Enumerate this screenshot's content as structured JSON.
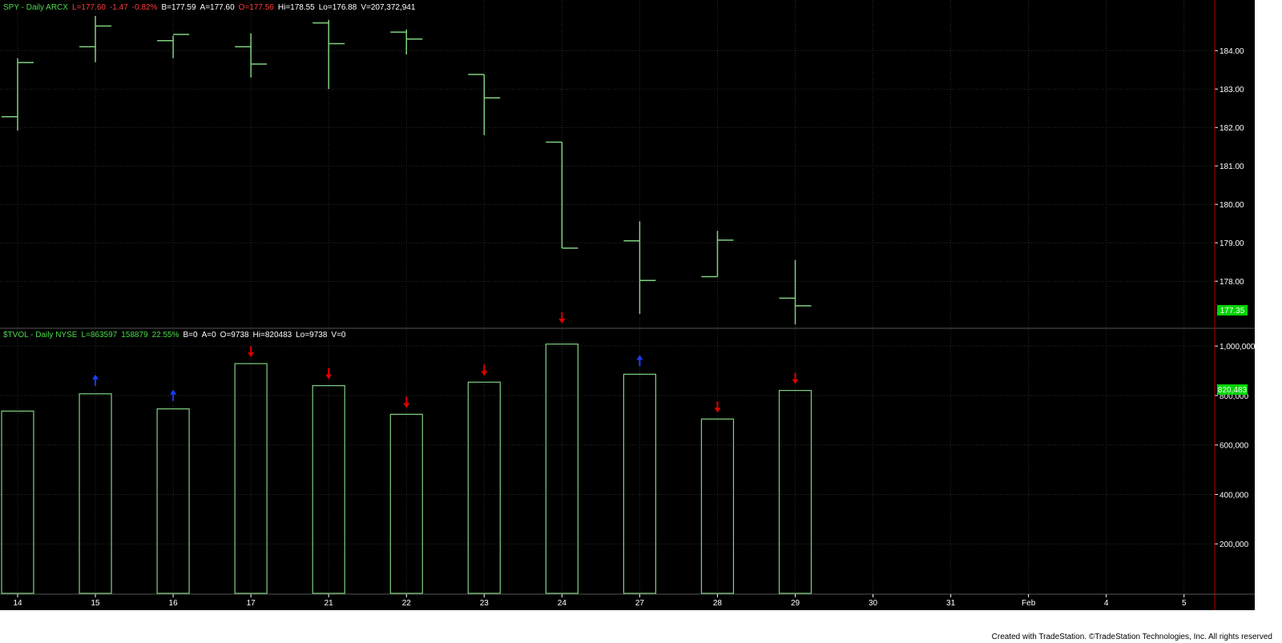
{
  "colors": {
    "background": "#000000",
    "bar": "#7fd17f",
    "grid": "#2a2a2a",
    "axis_text": "#ffffff",
    "header_green": "#4cd94c",
    "header_red": "#ff3b3b",
    "header_white": "#ffffff",
    "down_arrow": "#e00000",
    "up_arrow": "#1a3cff",
    "last_value_bg": "#00d400",
    "divider": "#b00000"
  },
  "price_panel": {
    "header": [
      {
        "text": "SPY - Daily  ARCX",
        "color": "green"
      },
      {
        "text": "L=177.60",
        "color": "red"
      },
      {
        "text": "-1.47",
        "color": "red"
      },
      {
        "text": "-0.82%",
        "color": "red"
      },
      {
        "text": "B=177.59",
        "color": "white"
      },
      {
        "text": "A=177.60",
        "color": "white"
      },
      {
        "text": "O=177.56",
        "color": "red"
      },
      {
        "text": "Hi=178.55",
        "color": "white"
      },
      {
        "text": "Lo=176.88",
        "color": "white"
      },
      {
        "text": "V=207,372,941",
        "color": "white"
      }
    ],
    "last_value_label": "177.35"
  },
  "volume_panel": {
    "header": [
      {
        "text": "$TVOL - Daily  NYSE",
        "color": "green"
      },
      {
        "text": "L=863597",
        "color": "green"
      },
      {
        "text": "158879",
        "color": "green"
      },
      {
        "text": "22.55%",
        "color": "green"
      },
      {
        "text": "B=0",
        "color": "white"
      },
      {
        "text": "A=0",
        "color": "white"
      },
      {
        "text": "O=9738",
        "color": "white"
      },
      {
        "text": "Hi=820483",
        "color": "white"
      },
      {
        "text": "Lo=9738",
        "color": "white"
      },
      {
        "text": "V=0",
        "color": "white"
      }
    ],
    "last_value_label": "820,483"
  },
  "chart_data": [
    {
      "type": "ohlc",
      "title": "SPY - Daily  ARCX",
      "ylim": [
        176.9,
        184.9
      ],
      "y_ticks": [
        178,
        179,
        180,
        181,
        182,
        183,
        184
      ],
      "y_tick_labels": [
        "178.00",
        "179.00",
        "180.00",
        "181.00",
        "182.00",
        "183.00",
        "184.00"
      ],
      "categories": [
        "14",
        "15",
        "16",
        "17",
        "21",
        "22",
        "23",
        "24",
        "27",
        "28",
        "29"
      ],
      "open": [
        182.28,
        184.1,
        184.26,
        184.1,
        184.72,
        184.48,
        183.38,
        181.62,
        179.05,
        178.12,
        177.56
      ],
      "high": [
        183.8,
        184.9,
        184.39,
        184.45,
        184.8,
        184.55,
        183.38,
        181.62,
        179.56,
        179.31,
        178.55
      ],
      "low": [
        181.92,
        183.7,
        183.8,
        183.3,
        183.0,
        183.9,
        181.8,
        178.86,
        177.15,
        178.12,
        176.88
      ],
      "close": [
        183.69,
        184.64,
        184.42,
        183.65,
        184.18,
        184.3,
        182.77,
        178.86,
        178.02,
        179.07,
        177.36
      ],
      "grid": true
    },
    {
      "type": "bar",
      "title": "$TVOL - Daily  NYSE",
      "ylim": [
        0,
        1020000
      ],
      "y_ticks": [
        200000,
        400000,
        600000,
        800000,
        1000000
      ],
      "y_tick_labels": [
        "200,000",
        "400,000",
        "600,000",
        "800,000",
        "1,000,000"
      ],
      "categories": [
        "14",
        "15",
        "16",
        "17",
        "21",
        "22",
        "23",
        "24",
        "27",
        "28",
        "29"
      ],
      "values": [
        737000,
        807000,
        746000,
        929000,
        840000,
        724000,
        854000,
        1008000,
        886000,
        705000,
        820483
      ],
      "signals": [
        "none",
        "up",
        "up",
        "down",
        "down",
        "down",
        "down",
        "down",
        "up",
        "down",
        "down"
      ],
      "grid": true
    }
  ],
  "x_axis": {
    "labels": [
      "14",
      "15",
      "16",
      "17",
      "21",
      "22",
      "23",
      "24",
      "27",
      "28",
      "29",
      "30",
      "31",
      "Feb",
      "4",
      "5"
    ]
  },
  "footer": {
    "credit": "Created with TradeStation. ©TradeStation Technologies, Inc. All rights reserved"
  }
}
